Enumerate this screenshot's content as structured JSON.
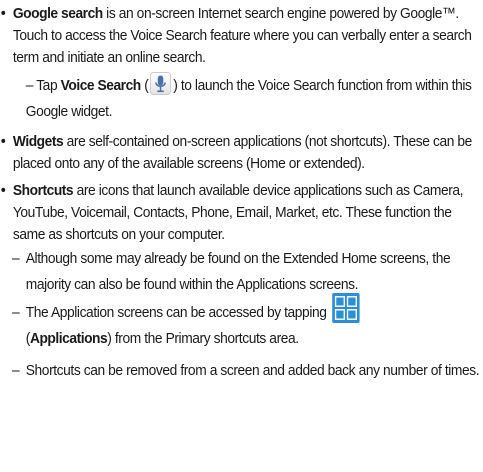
{
  "b1": {
    "term": "Google search",
    "text": " is an on-screen Internet search engine powered by Google™. Touch to access the Voice Search feature where you can verbally enter a search term and initiate an online search."
  },
  "b1_sub": {
    "pre": "– Tap ",
    "term": "Voice Search",
    "open": " (",
    "close": ") to launch the Voice Search function from within this Google widget.",
    "icon": "microphone-icon"
  },
  "b2": {
    "term": "Widgets",
    "text": " are self-contained on-screen applications (not shortcuts). These can be placed onto any of the available screens (Home or extended)."
  },
  "b3": {
    "term": "Shortcuts",
    "text": " are icons that launch available device applications such as Camera, YouTube, Voicemail, Contacts, Phone, Email, Market, etc. These function the same as shortcuts on your computer."
  },
  "b3_sub1": "Although some may already be found on the Extended Home screens, the majority can also be found within the Applications screens.",
  "b3_sub2": {
    "pre": "The Application screens can be accessed by tapping",
    "open": "(",
    "term": "Applications",
    "close": ") from the Primary shortcuts area.",
    "icon": "applications-grid-icon"
  },
  "b3_sub3": "Shortcuts can be removed from a screen and added back any number of times.",
  "colors": {
    "apps_icon": "#2a8fd6",
    "mic_icon": "#4b6fa8"
  }
}
